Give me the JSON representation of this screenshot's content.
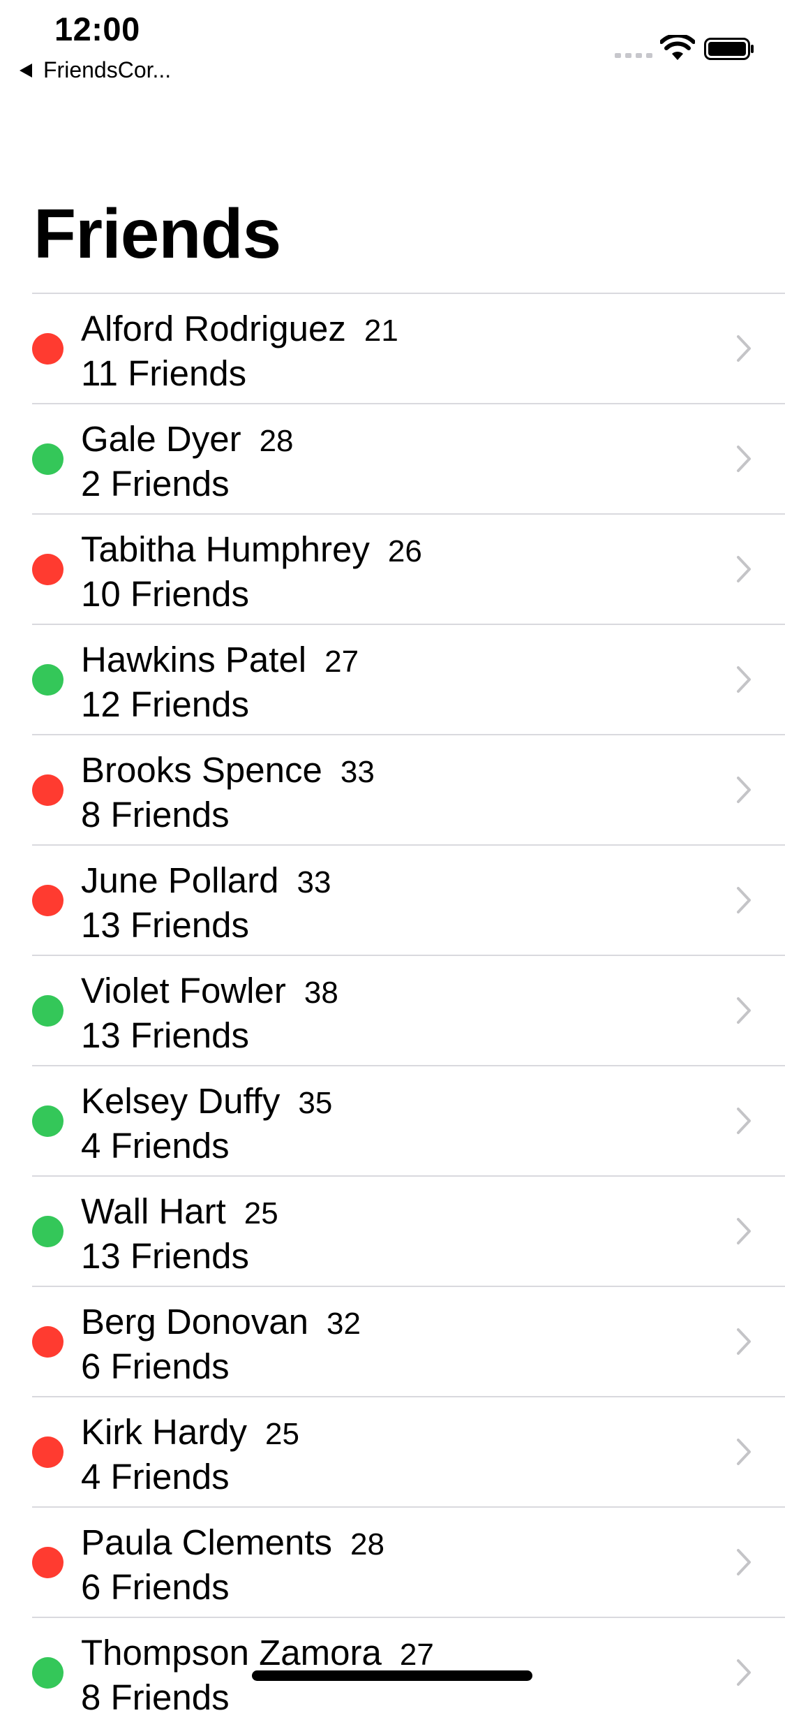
{
  "status_bar": {
    "time": "12:00",
    "back_app": "FriendsCor..."
  },
  "page": {
    "title": "Friends"
  },
  "colors": {
    "online": "#34c759",
    "offline": "#ff3b30",
    "chevron": "#c4c4c7"
  },
  "icons": {
    "back": "back-triangle-icon",
    "wifi": "wifi-icon",
    "battery": "battery-icon",
    "signal": "cellular-signal-icon",
    "row_disclosure": "chevron-right-icon"
  },
  "friends": [
    {
      "name": "Alford Rodriguez",
      "age": "21",
      "friends": "11 Friends",
      "status": "offline"
    },
    {
      "name": "Gale Dyer",
      "age": "28",
      "friends": "2 Friends",
      "status": "online"
    },
    {
      "name": "Tabitha Humphrey",
      "age": "26",
      "friends": "10 Friends",
      "status": "offline"
    },
    {
      "name": "Hawkins Patel",
      "age": "27",
      "friends": "12 Friends",
      "status": "online"
    },
    {
      "name": "Brooks Spence",
      "age": "33",
      "friends": "8 Friends",
      "status": "offline"
    },
    {
      "name": "June Pollard",
      "age": "33",
      "friends": "13 Friends",
      "status": "offline"
    },
    {
      "name": "Violet Fowler",
      "age": "38",
      "friends": "13 Friends",
      "status": "online"
    },
    {
      "name": "Kelsey Duffy",
      "age": "35",
      "friends": "4 Friends",
      "status": "online"
    },
    {
      "name": "Wall Hart",
      "age": "25",
      "friends": "13 Friends",
      "status": "online"
    },
    {
      "name": "Berg Donovan",
      "age": "32",
      "friends": "6 Friends",
      "status": "offline"
    },
    {
      "name": "Kirk Hardy",
      "age": "25",
      "friends": "4 Friends",
      "status": "offline"
    },
    {
      "name": "Paula Clements",
      "age": "28",
      "friends": "6 Friends",
      "status": "offline"
    },
    {
      "name": "Thompson Zamora",
      "age": "27",
      "friends": "8 Friends",
      "status": "online"
    }
  ]
}
